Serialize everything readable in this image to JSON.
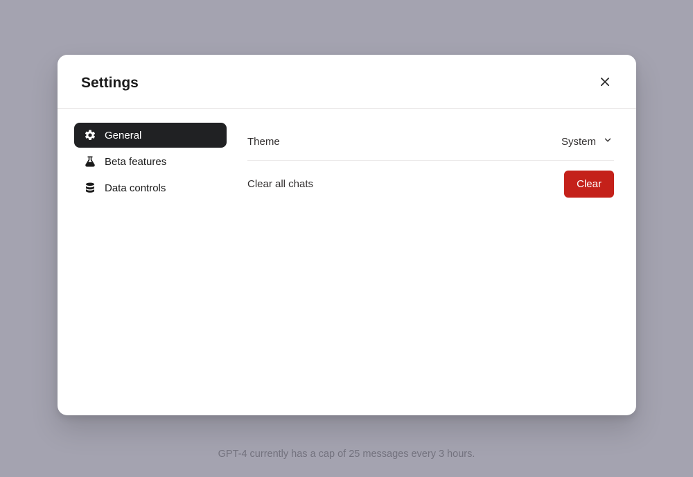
{
  "modal": {
    "title": "Settings"
  },
  "sidebar": {
    "items": [
      {
        "label": "General"
      },
      {
        "label": "Beta features"
      },
      {
        "label": "Data controls"
      }
    ]
  },
  "content": {
    "theme": {
      "label": "Theme",
      "value": "System"
    },
    "clear_chats": {
      "label": "Clear all chats",
      "button": "Clear"
    }
  },
  "footer": {
    "note": "GPT-4 currently has a cap of 25 messages every 3 hours."
  },
  "colors": {
    "danger": "#c4211a",
    "sidebar_active_bg": "#202123"
  }
}
